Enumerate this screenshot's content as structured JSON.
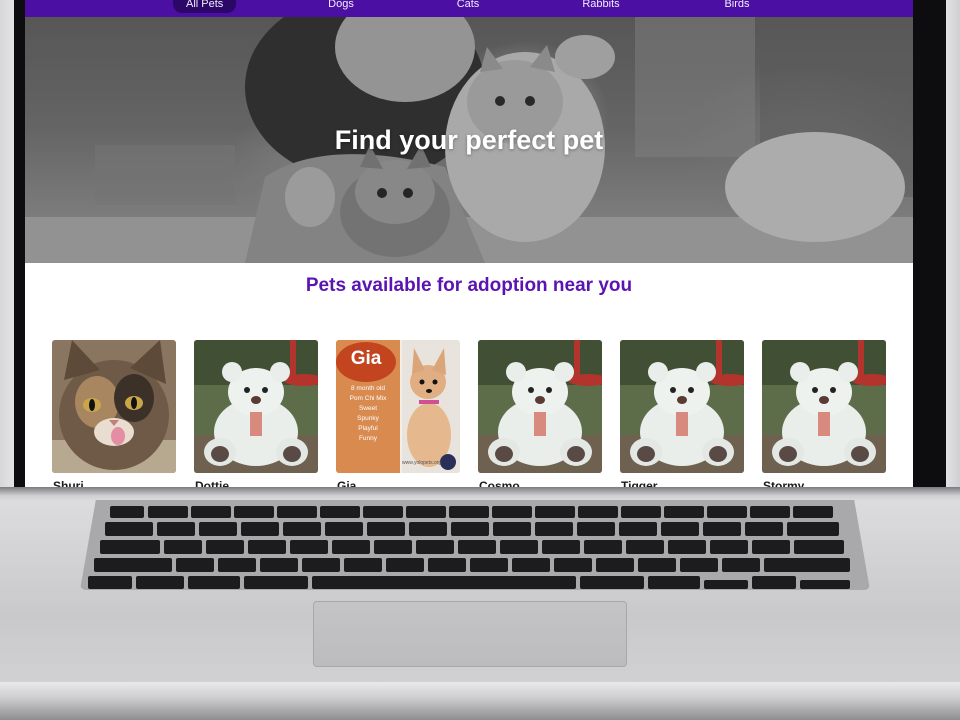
{
  "nav": {
    "items": [
      {
        "label": "All Pets",
        "active": true
      },
      {
        "label": "Dogs",
        "active": false
      },
      {
        "label": "Cats",
        "active": false
      },
      {
        "label": "Rabbits",
        "active": false
      },
      {
        "label": "Birds",
        "active": false
      }
    ],
    "color": "#4b0fa3",
    "active_color": "#2b0867"
  },
  "hero": {
    "title": "Find your perfect pet"
  },
  "section": {
    "title": "Pets available for adoption near you",
    "color": "#5a14b1"
  },
  "pets": [
    {
      "name": "Shuri",
      "photo": "cat-photo"
    },
    {
      "name": "Dottie",
      "photo": "teddy-bear-placeholder"
    },
    {
      "name": "Gia",
      "photo": "dog-flyer-photo",
      "flyer": {
        "title": "Gia",
        "lines": [
          "8 month old",
          "Pom Chi Mix",
          "Sweet",
          "Spunky",
          "Playful",
          "Funny"
        ],
        "footer": "www.yolopets.org"
      }
    },
    {
      "name": "Cosmo",
      "photo": "teddy-bear-placeholder"
    },
    {
      "name": "Tigger",
      "photo": "teddy-bear-placeholder"
    },
    {
      "name": "Stormy",
      "photo": "teddy-bear-placeholder"
    }
  ]
}
